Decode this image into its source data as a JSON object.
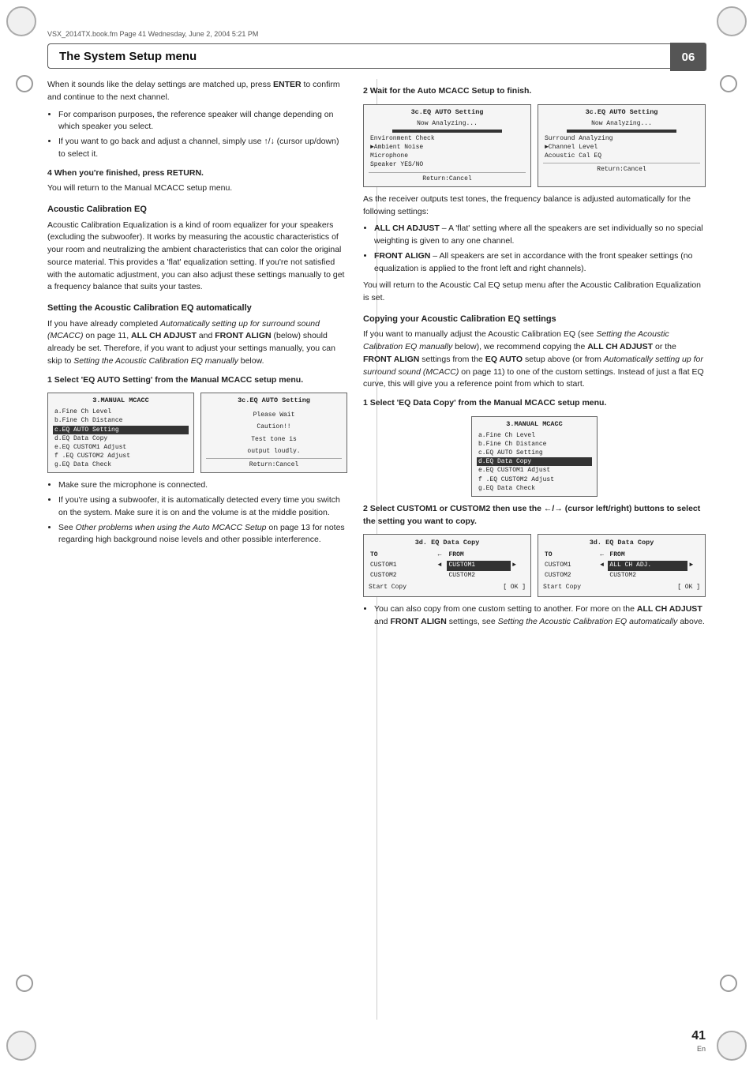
{
  "file_info": "VSX_2014TX.book.fm  Page 41  Wednesday, June 2, 2004  5:21 PM",
  "header": {
    "title": "The System Setup menu",
    "number": "06"
  },
  "left_col": {
    "intro_p1": "When it sounds like the delay settings are matched up, press ",
    "intro_enter": "ENTER",
    "intro_p1_cont": " to confirm and continue to the next channel.",
    "bullets_1": [
      "For comparison purposes, the reference speaker will change depending on which speaker you select.",
      "If you want to go back and adjust a channel, simply use ↑/↓ (cursor up/down) to select it."
    ],
    "step4_heading": "4   When you're finished, press RETURN.",
    "step4_body": "You will return to the Manual MCACC setup menu.",
    "acoustic_heading": "Acoustic Calibration EQ",
    "acoustic_body": "Acoustic Calibration Equalization is a kind of room equalizer for your speakers (excluding the subwoofer). It works by measuring the acoustic characteristics of your room and neutralizing the ambient characteristics that can color the original source material. This provides a 'flat' equalization setting. If you're not satisfied with the automatic adjustment, you can also adjust these settings manually to get a frequency balance that suits your tastes.",
    "setting_auto_heading": "Setting the Acoustic Calibration EQ automatically",
    "setting_auto_body1": "If you have already completed ",
    "setting_auto_italic1": "Automatically setting up for surround sound (MCACC)",
    "setting_auto_body2": " on page 11, ",
    "setting_auto_bold1": "ALL CH ADJUST",
    "setting_auto_body3": " and ",
    "setting_auto_bold2": "FRONT ALIGN",
    "setting_auto_body4": " (below) should already be set. Therefore, if you want to adjust your settings manually, you can skip to ",
    "setting_auto_italic2": "Setting the Acoustic Calibration EQ manually",
    "setting_auto_body5": " below.",
    "step1_heading": "1   Select 'EQ AUTO Setting' from the Manual MCACC setup menu.",
    "screen1_left": {
      "title": "3.MANUAL MCACC",
      "items": [
        "a.Fine Ch Level",
        "b.Fine Ch Distance",
        "c.EQ AUTO Setting",
        "d.EQ Data Copy",
        "e.EQ CUSTOM1 Adjust",
        "f .EQ CUSTOM2 Adjust",
        "g.EQ Data Check"
      ],
      "selected_index": 2
    },
    "screen1_right": {
      "title": "3c.EQ AUTO Setting",
      "wait_text": "Please Wait",
      "caution": "Caution!!",
      "caution2": "Test tone is",
      "caution3": "output loudly.",
      "return_label": "Return:Cancel"
    },
    "bullets_2": [
      "Make sure the microphone is connected.",
      "If you're using a subwoofer, it is automatically detected every time you switch on the system. Make sure it is on and the volume is at the middle position.",
      "See Other problems when using the Auto MCACC Setup on page 13 for notes regarding high background noise levels and other possible interference."
    ]
  },
  "right_col": {
    "step2_heading": "2   Wait for the Auto MCACC Setup to finish.",
    "screen2_left": {
      "title": "3c.EQ AUTO Setting",
      "now_analyzing": "Now Analyzing...",
      "progress_shown": true,
      "items": [
        "Environment Check",
        "►Ambient Noise",
        "Microphone",
        "Speaker YES/NO"
      ],
      "return_label": "Return:Cancel"
    },
    "screen2_right": {
      "title": "3c.EQ AUTO Setting",
      "now_analyzing": "Now Analyzing...",
      "progress_shown": true,
      "items": [
        "Surround Analyzing",
        "►Channel Level",
        "Acoustic Cal EQ"
      ],
      "return_label": "Return:Cancel"
    },
    "body_after_screens": "As the receiver outputs test tones, the frequency balance is adjusted automatically for the following settings:",
    "bullets_settings": [
      {
        "bold": "ALL CH ADJUST",
        "text": " – A 'flat' setting where all the speakers are set individually so no special weighting is given to any one channel."
      },
      {
        "bold": "FRONT ALIGN",
        "text": " – All speakers are set in accordance with the front speaker settings (no equalization is applied to the front left and right channels)."
      }
    ],
    "after_bullets": "You will return to the Acoustic Cal EQ setup menu after the Acoustic Calibration Equalization is set.",
    "copy_heading": "Copying your Acoustic Calibration EQ settings",
    "copy_body1": "If you want to manually adjust the Acoustic Calibration EQ (see ",
    "copy_italic1": "Setting the Acoustic Calibration EQ manually",
    "copy_body2": " below), we recommend copying the ",
    "copy_bold1": "ALL CH ADJUST",
    "copy_body3": " or the ",
    "copy_bold2": "FRONT ALIGN",
    "copy_body4": " settings from the ",
    "copy_bold3": "EQ AUTO",
    "copy_body5": " setup above (or from ",
    "copy_italic2": "Automatically setting up for surround sound (MCACC)",
    "copy_body6": " on page 11) to one of the custom settings. Instead of just a flat EQ curve, this will give you a reference point from which to start.",
    "step1_copy_heading": "1   Select 'EQ Data Copy' from the Manual MCACC setup menu.",
    "screen_copy": {
      "title": "3.MANUAL MCACC",
      "items": [
        "a.Fine Ch Level",
        "b.Fine Ch Distance",
        "c.EQ AUTO Setting",
        "d.EQ Data Copy",
        "e.EQ CUSTOM1 Adjust",
        "f .EQ CUSTOM2 Adjust",
        "g.EQ Data Check"
      ],
      "selected_index": 3
    },
    "step2_copy_heading": "2   Select CUSTOM1 or CUSTOM2 then use the ←/→ (cursor left/right) buttons to select the setting you want to copy.",
    "screen_copy2_left": {
      "title": "3d. EQ Data Copy",
      "to_label": "TO",
      "from_label": "FROM",
      "to_value": "CUSTOM1",
      "to_value2": "CUSTOM2",
      "from_value_selected": "CUSTOM1",
      "from_value2": "",
      "start_copy": "Start Copy",
      "ok_label": "[ OK ]"
    },
    "screen_copy2_right": {
      "title": "3d. EQ Data Copy",
      "to_label": "TO",
      "from_label": "FROM",
      "to_value": "CUSTOM1",
      "to_value2": "CUSTOM2",
      "from_value_selected": "ALL CH ADJ.",
      "from_value2": "CUSTOM2",
      "start_copy": "Start Copy",
      "ok_label": "[ OK ]"
    },
    "bullets_copy": [
      {
        "text": "You can also copy from one custom setting to another. For more on the ",
        "bold1": "ALL CH ADJUST",
        "text2": " and ",
        "bold2": "FRONT ALIGN",
        "text3": " settings, see ",
        "italic": "Setting the Acoustic Calibration EQ automatically",
        "text4": " above."
      }
    ]
  },
  "page_number": "41",
  "page_lang": "En"
}
